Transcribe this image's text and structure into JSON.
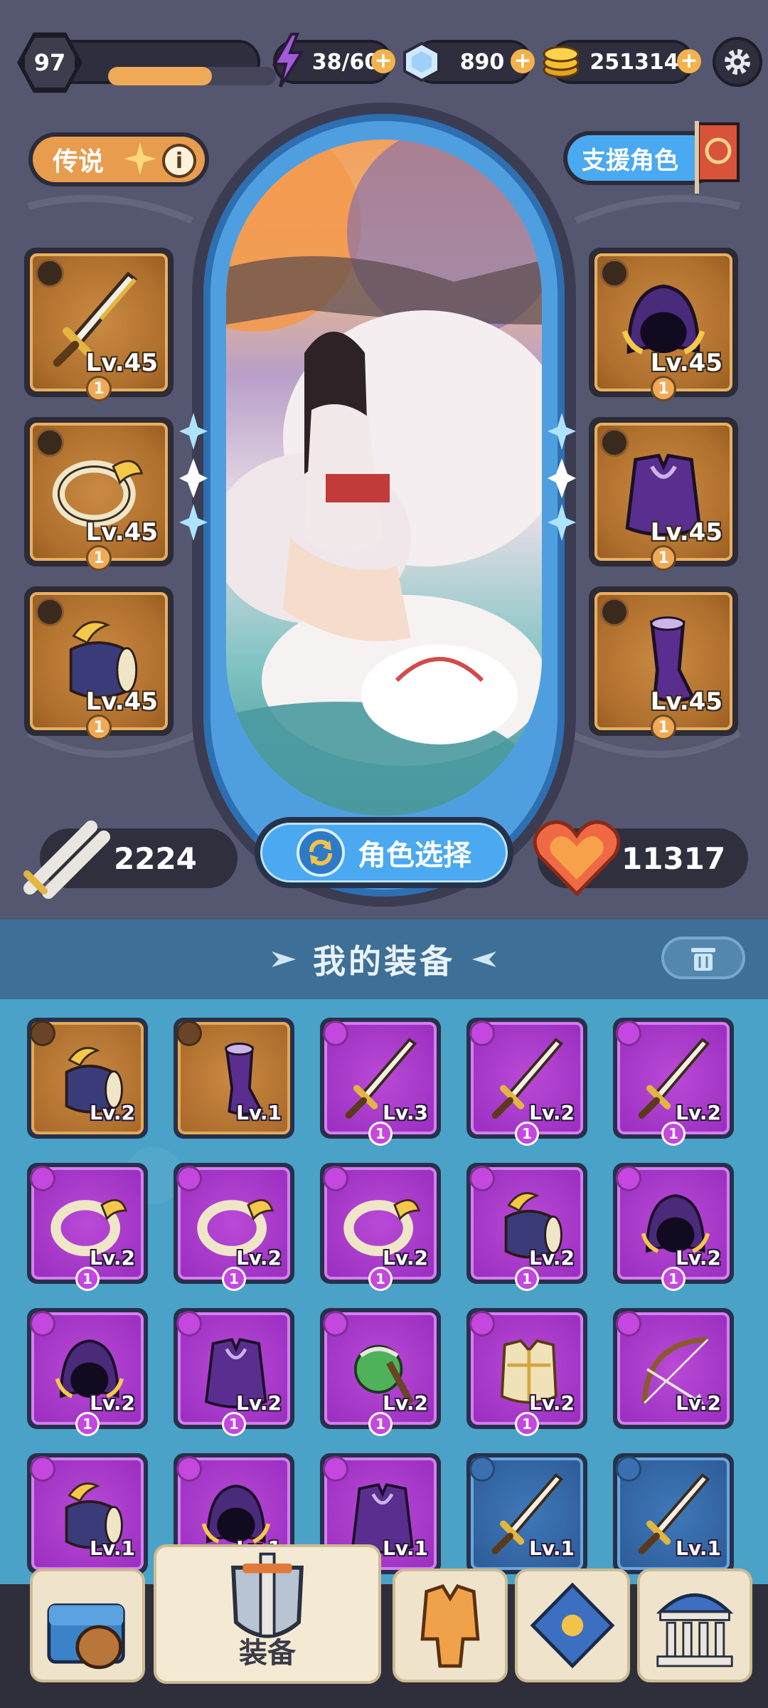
{
  "topbar": {
    "player_level": "97",
    "xp_progress": 0.62,
    "energy": "38/60",
    "gems": "890",
    "gold": "251314"
  },
  "character": {
    "rarity_label": "传说",
    "support_label": "支援角色",
    "attack": "2224",
    "hp": "11317",
    "select_label": "角色选择",
    "left_slots": [
      {
        "type": "sword",
        "level": "Lv.45",
        "count": "1"
      },
      {
        "type": "ring",
        "level": "Lv.45",
        "count": "1"
      },
      {
        "type": "bracer",
        "level": "Lv.45",
        "count": "1"
      }
    ],
    "right_slots": [
      {
        "type": "hood",
        "level": "Lv.45",
        "count": "1"
      },
      {
        "type": "armor",
        "level": "Lv.45",
        "count": "1"
      },
      {
        "type": "boots",
        "level": "Lv.45",
        "count": "1"
      }
    ]
  },
  "inventory": {
    "title": "我的装备",
    "items": [
      {
        "type": "bracer",
        "rarity": "brown",
        "level": "Lv.2",
        "count": ""
      },
      {
        "type": "boots",
        "rarity": "brown",
        "level": "Lv.1",
        "count": ""
      },
      {
        "type": "sword",
        "rarity": "purple",
        "level": "Lv.3",
        "count": "1"
      },
      {
        "type": "sword",
        "rarity": "purple",
        "level": "Lv.2",
        "count": "1"
      },
      {
        "type": "sword",
        "rarity": "purple",
        "level": "Lv.2",
        "count": "1"
      },
      {
        "type": "ring",
        "rarity": "purple",
        "level": "Lv.2",
        "count": "1"
      },
      {
        "type": "ring",
        "rarity": "purple",
        "level": "Lv.2",
        "count": "1"
      },
      {
        "type": "ring",
        "rarity": "purple",
        "level": "Lv.2",
        "count": "1"
      },
      {
        "type": "bracer",
        "rarity": "purple",
        "level": "Lv.2",
        "count": "1"
      },
      {
        "type": "hood",
        "rarity": "purple",
        "level": "Lv.2",
        "count": "1"
      },
      {
        "type": "hood",
        "rarity": "purple",
        "level": "Lv.2",
        "count": "1"
      },
      {
        "type": "armor",
        "rarity": "purple",
        "level": "Lv.2",
        "count": "1"
      },
      {
        "type": "cape",
        "rarity": "purple",
        "level": "Lv.2",
        "count": "1"
      },
      {
        "type": "chest",
        "rarity": "purple",
        "level": "Lv.2",
        "count": "1"
      },
      {
        "type": "bow",
        "rarity": "purple",
        "level": "Lv.2",
        "count": ""
      },
      {
        "type": "bracer",
        "rarity": "purple",
        "level": "Lv.1",
        "count": ""
      },
      {
        "type": "hood",
        "rarity": "purple",
        "level": "Lv.1",
        "count": ""
      },
      {
        "type": "armor",
        "rarity": "purple",
        "level": "Lv.1",
        "count": ""
      },
      {
        "type": "sword",
        "rarity": "blue",
        "level": "Lv.1",
        "count": ""
      },
      {
        "type": "sword",
        "rarity": "blue",
        "level": "Lv.1",
        "count": ""
      }
    ]
  },
  "nav": {
    "equipment_label": "装备"
  },
  "colors": {
    "brown_tile": "#b0702e",
    "purple_tile": "#9a2ec0",
    "blue_tile": "#2d5c98",
    "accent_orange": "#f0a957",
    "accent_blue": "#4aa9f0"
  }
}
